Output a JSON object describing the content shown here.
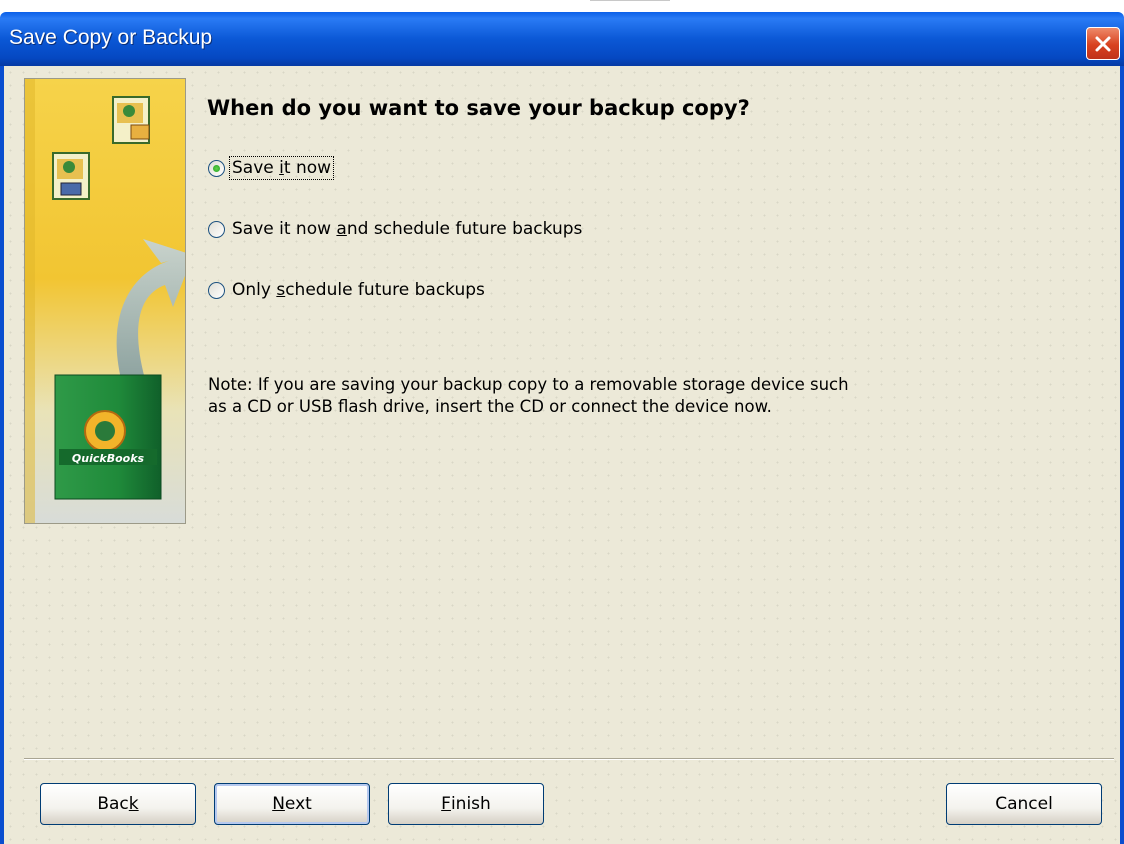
{
  "window": {
    "title": "Save Copy or Backup"
  },
  "side_image": {
    "logo_text": "QuickBooks"
  },
  "page": {
    "heading": "When do you want to save your backup copy?"
  },
  "options": [
    {
      "pre": "Save ",
      "key": "i",
      "post": "t now",
      "checked": true
    },
    {
      "pre": "Save it now ",
      "key": "a",
      "post": "nd schedule future backups",
      "checked": false
    },
    {
      "pre": "Only ",
      "key": "s",
      "post": "chedule future backups",
      "checked": false
    }
  ],
  "note": {
    "line1": "Note: If you are saving your backup copy to a removable storage device such",
    "line2": "as a CD or USB flash drive, insert the CD or connect the device now."
  },
  "buttons": {
    "back": {
      "pre": "Bac",
      "key": "k",
      "post": ""
    },
    "next": {
      "pre": "",
      "key": "N",
      "post": "ext"
    },
    "finish": {
      "pre": "",
      "key": "F",
      "post": "inish"
    },
    "cancel": {
      "label": "Cancel"
    }
  },
  "colors": {
    "titlebar": "#0b58d6",
    "dialog_background": "#ece9d8",
    "side_image_gold": "#f2c532",
    "box_green": "#1f8a3a"
  }
}
